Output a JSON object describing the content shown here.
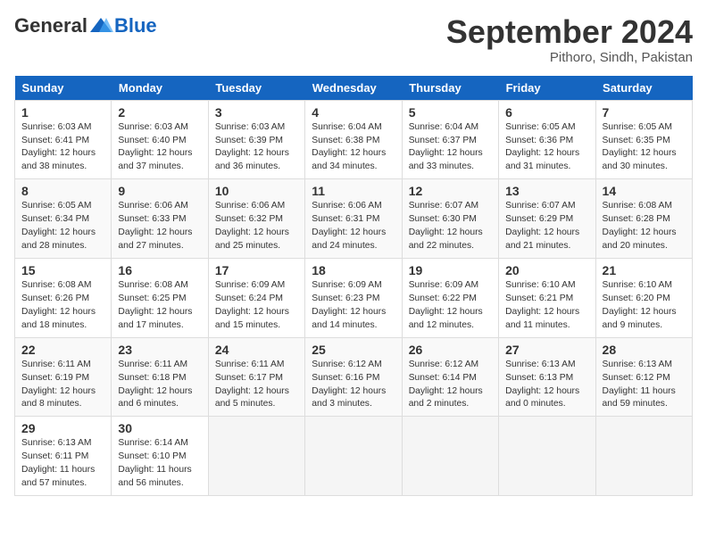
{
  "header": {
    "logo_general": "General",
    "logo_blue": "Blue",
    "month_title": "September 2024",
    "location": "Pithoro, Sindh, Pakistan"
  },
  "days_of_week": [
    "Sunday",
    "Monday",
    "Tuesday",
    "Wednesday",
    "Thursday",
    "Friday",
    "Saturday"
  ],
  "weeks": [
    [
      {
        "day": "1",
        "info": "Sunrise: 6:03 AM\nSunset: 6:41 PM\nDaylight: 12 hours and 38 minutes."
      },
      {
        "day": "2",
        "info": "Sunrise: 6:03 AM\nSunset: 6:40 PM\nDaylight: 12 hours and 37 minutes."
      },
      {
        "day": "3",
        "info": "Sunrise: 6:03 AM\nSunset: 6:39 PM\nDaylight: 12 hours and 36 minutes."
      },
      {
        "day": "4",
        "info": "Sunrise: 6:04 AM\nSunset: 6:38 PM\nDaylight: 12 hours and 34 minutes."
      },
      {
        "day": "5",
        "info": "Sunrise: 6:04 AM\nSunset: 6:37 PM\nDaylight: 12 hours and 33 minutes."
      },
      {
        "day": "6",
        "info": "Sunrise: 6:05 AM\nSunset: 6:36 PM\nDaylight: 12 hours and 31 minutes."
      },
      {
        "day": "7",
        "info": "Sunrise: 6:05 AM\nSunset: 6:35 PM\nDaylight: 12 hours and 30 minutes."
      }
    ],
    [
      {
        "day": "8",
        "info": "Sunrise: 6:05 AM\nSunset: 6:34 PM\nDaylight: 12 hours and 28 minutes."
      },
      {
        "day": "9",
        "info": "Sunrise: 6:06 AM\nSunset: 6:33 PM\nDaylight: 12 hours and 27 minutes."
      },
      {
        "day": "10",
        "info": "Sunrise: 6:06 AM\nSunset: 6:32 PM\nDaylight: 12 hours and 25 minutes."
      },
      {
        "day": "11",
        "info": "Sunrise: 6:06 AM\nSunset: 6:31 PM\nDaylight: 12 hours and 24 minutes."
      },
      {
        "day": "12",
        "info": "Sunrise: 6:07 AM\nSunset: 6:30 PM\nDaylight: 12 hours and 22 minutes."
      },
      {
        "day": "13",
        "info": "Sunrise: 6:07 AM\nSunset: 6:29 PM\nDaylight: 12 hours and 21 minutes."
      },
      {
        "day": "14",
        "info": "Sunrise: 6:08 AM\nSunset: 6:28 PM\nDaylight: 12 hours and 20 minutes."
      }
    ],
    [
      {
        "day": "15",
        "info": "Sunrise: 6:08 AM\nSunset: 6:26 PM\nDaylight: 12 hours and 18 minutes."
      },
      {
        "day": "16",
        "info": "Sunrise: 6:08 AM\nSunset: 6:25 PM\nDaylight: 12 hours and 17 minutes."
      },
      {
        "day": "17",
        "info": "Sunrise: 6:09 AM\nSunset: 6:24 PM\nDaylight: 12 hours and 15 minutes."
      },
      {
        "day": "18",
        "info": "Sunrise: 6:09 AM\nSunset: 6:23 PM\nDaylight: 12 hours and 14 minutes."
      },
      {
        "day": "19",
        "info": "Sunrise: 6:09 AM\nSunset: 6:22 PM\nDaylight: 12 hours and 12 minutes."
      },
      {
        "day": "20",
        "info": "Sunrise: 6:10 AM\nSunset: 6:21 PM\nDaylight: 12 hours and 11 minutes."
      },
      {
        "day": "21",
        "info": "Sunrise: 6:10 AM\nSunset: 6:20 PM\nDaylight: 12 hours and 9 minutes."
      }
    ],
    [
      {
        "day": "22",
        "info": "Sunrise: 6:11 AM\nSunset: 6:19 PM\nDaylight: 12 hours and 8 minutes."
      },
      {
        "day": "23",
        "info": "Sunrise: 6:11 AM\nSunset: 6:18 PM\nDaylight: 12 hours and 6 minutes."
      },
      {
        "day": "24",
        "info": "Sunrise: 6:11 AM\nSunset: 6:17 PM\nDaylight: 12 hours and 5 minutes."
      },
      {
        "day": "25",
        "info": "Sunrise: 6:12 AM\nSunset: 6:16 PM\nDaylight: 12 hours and 3 minutes."
      },
      {
        "day": "26",
        "info": "Sunrise: 6:12 AM\nSunset: 6:14 PM\nDaylight: 12 hours and 2 minutes."
      },
      {
        "day": "27",
        "info": "Sunrise: 6:13 AM\nSunset: 6:13 PM\nDaylight: 12 hours and 0 minutes."
      },
      {
        "day": "28",
        "info": "Sunrise: 6:13 AM\nSunset: 6:12 PM\nDaylight: 11 hours and 59 minutes."
      }
    ],
    [
      {
        "day": "29",
        "info": "Sunrise: 6:13 AM\nSunset: 6:11 PM\nDaylight: 11 hours and 57 minutes."
      },
      {
        "day": "30",
        "info": "Sunrise: 6:14 AM\nSunset: 6:10 PM\nDaylight: 11 hours and 56 minutes."
      },
      {
        "day": "",
        "info": ""
      },
      {
        "day": "",
        "info": ""
      },
      {
        "day": "",
        "info": ""
      },
      {
        "day": "",
        "info": ""
      },
      {
        "day": "",
        "info": ""
      }
    ]
  ]
}
